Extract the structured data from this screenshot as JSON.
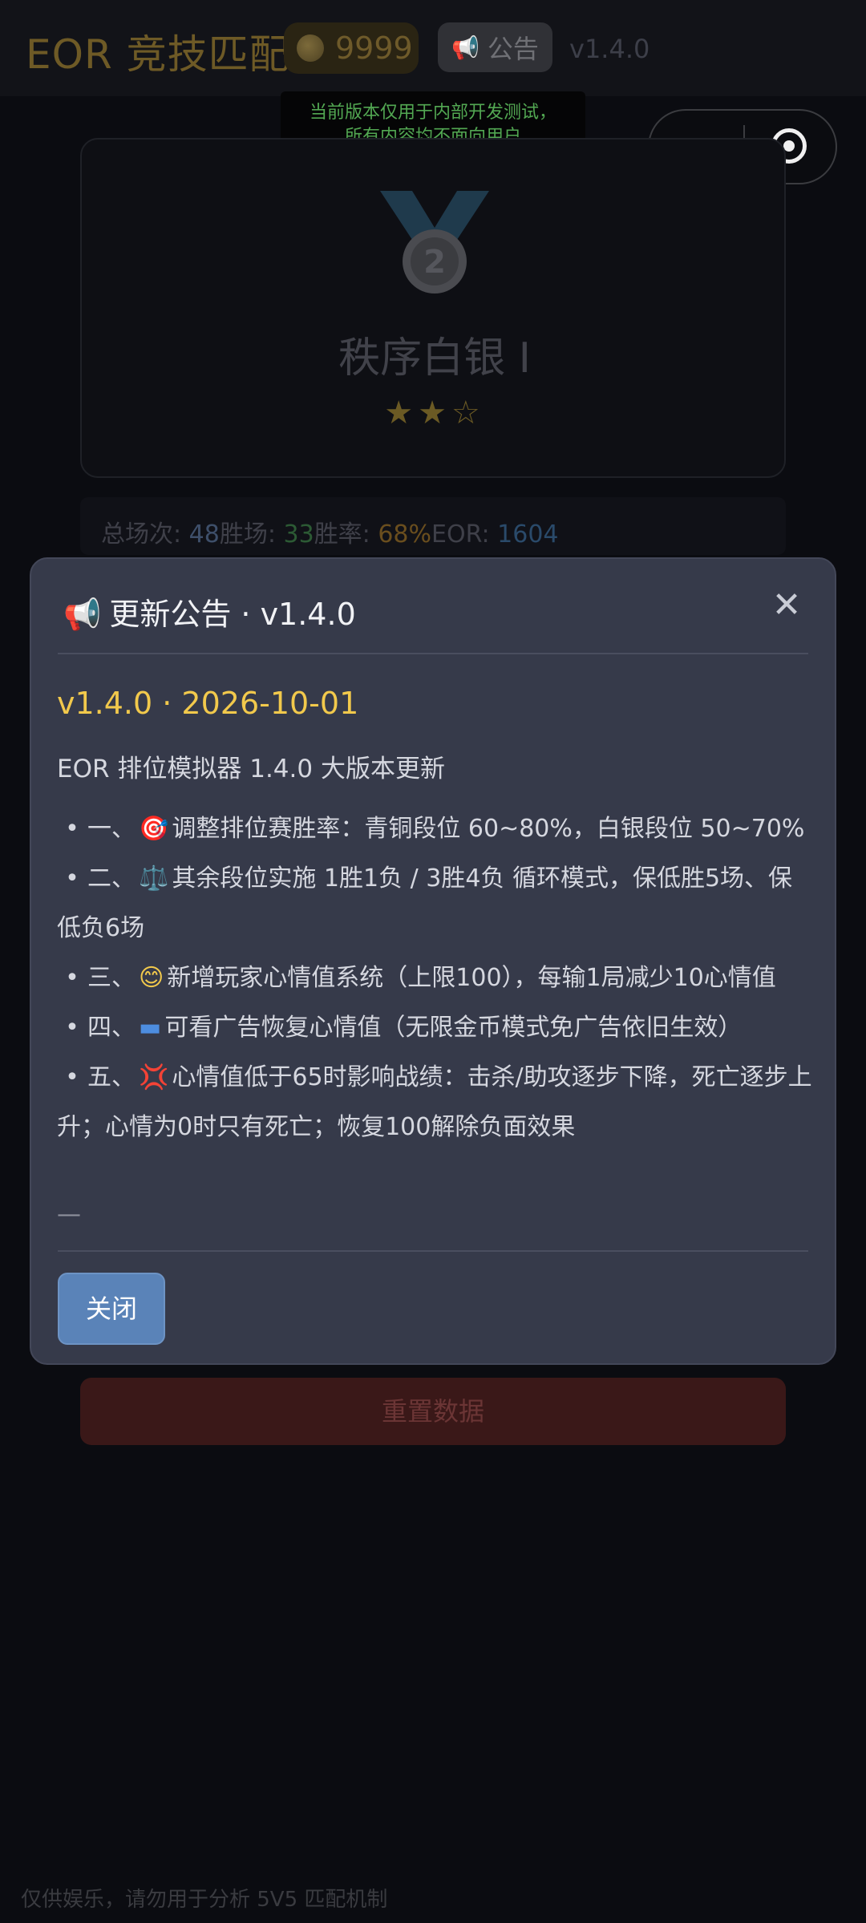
{
  "header": {
    "app_title": "EOR 竞技匹配",
    "coins": "9999",
    "notice_label": "公告",
    "version": "v1.4.0"
  },
  "dev_notice": {
    "line1": "当前版本仅用于内部开发测试，",
    "line2": "所有内容均不面向用户"
  },
  "capsule": {
    "menu_glyph": "•●•"
  },
  "rank": {
    "medal_number": "2",
    "name": "秩序白银 I",
    "stars": "★★☆",
    "star_rating": 2,
    "star_max": 3
  },
  "stats": {
    "total_label": "总场次: ",
    "total_value": "48",
    "win_label": "胜场: ",
    "win_value": "33",
    "rate_label": "胜率: ",
    "rate_value": "68%",
    "eor_label": "EOR: ",
    "eor_value": "1604"
  },
  "modal": {
    "title": "更新公告 · v1.4.0",
    "close_glyph": "✕",
    "version_line": "v1.4.0 · 2026-10-01",
    "subtitle": "EOR 排位模拟器 1.4.0 大版本更新",
    "bullets": [
      {
        "prefix": "一、",
        "icon": "🎯",
        "icon_name": "target-icon",
        "text": "调整排位赛胜率：青铜段位 60~80%，白银段位 50~70%"
      },
      {
        "prefix": "二、",
        "icon": "⚖️",
        "icon_name": "scale-icon",
        "text": "其余段位实施 1胜1负 / 3胜4负 循环模式，保低胜5场、保低负6场"
      },
      {
        "prefix": "三、",
        "icon": "😊",
        "icon_name": "smile-icon",
        "text": "新增玩家心情值系统（上限100），每输1局减少10心情值"
      },
      {
        "prefix": "四、",
        "icon": "▬",
        "icon_name": "ad-icon",
        "text": "可看广告恢复心情值（无限金币模式免广告依旧生效）"
      },
      {
        "prefix": "五、",
        "icon": "💢",
        "icon_name": "anger-icon",
        "text": "心情值低于65时影响战绩：击杀/助攻逐步下降，死亡逐步上升；心情为0时只有死亡；恢复100解除负面效果"
      }
    ],
    "dash": "—",
    "close_button": "关闭"
  },
  "reset_button": "重置数据",
  "footer_note": "仅供娱乐，请勿用于分析 5V5 匹配机制",
  "colors": {
    "accent_gold": "#f2c94c",
    "modal_bg": "#363a4a",
    "close_button_bg": "#5a83b8",
    "reset_bg": "#3a1818"
  }
}
